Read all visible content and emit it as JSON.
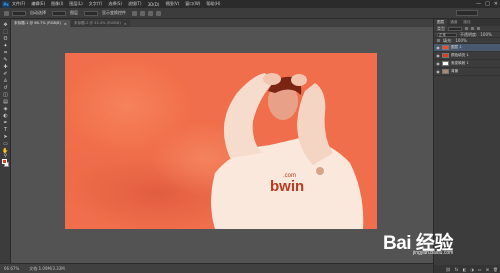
{
  "app": {
    "logo": "Ps",
    "menu": [
      "文件(F)",
      "编辑(E)",
      "图像(I)",
      "图层(L)",
      "文字(Y)",
      "选择(S)",
      "滤镜(T)",
      "3D(D)",
      "视图(V)",
      "窗口(W)",
      "帮助(H)"
    ],
    "window_controls": [
      "—",
      "□",
      "✕"
    ]
  },
  "options_bar": {
    "items": [
      "自动选择",
      "图层",
      "显示变换控件"
    ]
  },
  "tabs": [
    {
      "label": "未标题-1 @ 66.7% (RGB/8)",
      "active": true
    },
    {
      "label": "未标题-2 @ 33.3% (RGB/8)",
      "active": false
    }
  ],
  "tools": [
    {
      "icon": "move-tool-icon",
      "glyph": "✥"
    },
    {
      "icon": "marquee-tool-icon",
      "glyph": "⬚"
    },
    {
      "icon": "lasso-tool-icon",
      "glyph": "ʘ"
    },
    {
      "icon": "magic-wand-icon",
      "glyph": "✦"
    },
    {
      "icon": "crop-tool-icon",
      "glyph": "⌗"
    },
    {
      "icon": "eyedropper-icon",
      "glyph": "✎"
    },
    {
      "icon": "healing-brush-icon",
      "glyph": "✚"
    },
    {
      "icon": "brush-tool-icon",
      "glyph": "✐"
    },
    {
      "icon": "clone-stamp-icon",
      "glyph": "♙"
    },
    {
      "icon": "history-brush-icon",
      "glyph": "↺"
    },
    {
      "icon": "eraser-tool-icon",
      "glyph": "◫"
    },
    {
      "icon": "gradient-tool-icon",
      "glyph": "▤"
    },
    {
      "icon": "blur-tool-icon",
      "glyph": "◈"
    },
    {
      "icon": "dodge-tool-icon",
      "glyph": "◐"
    },
    {
      "icon": "pen-tool-icon",
      "glyph": "✒"
    },
    {
      "icon": "type-tool-icon",
      "glyph": "T"
    },
    {
      "icon": "path-selection-icon",
      "glyph": "➤"
    },
    {
      "icon": "shape-tool-icon",
      "glyph": "▭"
    },
    {
      "icon": "hand-tool-icon",
      "glyph": "✋"
    },
    {
      "icon": "zoom-tool-icon",
      "glyph": "⚲"
    }
  ],
  "colors": {
    "foreground": "#e03c1a",
    "background": "#f5f5f5",
    "canvas": "#ec4f2a"
  },
  "panels": {
    "tabs": [
      "图层",
      "通道",
      "路径"
    ],
    "kind_label": "类型",
    "blend_mode": "正常",
    "opacity_label": "不透明度:",
    "opacity_value": "100%",
    "fill_label": "填充:",
    "fill_value": "100%",
    "layers": [
      {
        "name": "图层 1",
        "selected": true,
        "thumb": "#ec4f2a"
      },
      {
        "name": "颜色填充 1",
        "selected": false,
        "thumb": "#e03c1a"
      },
      {
        "name": "渐变映射 1",
        "selected": false,
        "thumb": "#ffffff"
      },
      {
        "name": "背景",
        "selected": false,
        "thumb": "#aa8877"
      }
    ],
    "footer_icons": [
      "link-icon",
      "fx-icon",
      "mask-icon",
      "adjustment-icon",
      "folder-icon",
      "new-layer-icon",
      "trash-icon"
    ]
  },
  "status": {
    "zoom": "66.67%",
    "doc_size": "文档:1.09M/3.33M"
  },
  "watermark": {
    "text": "Bai 经验",
    "sub": "jingyan.baidu.com"
  }
}
